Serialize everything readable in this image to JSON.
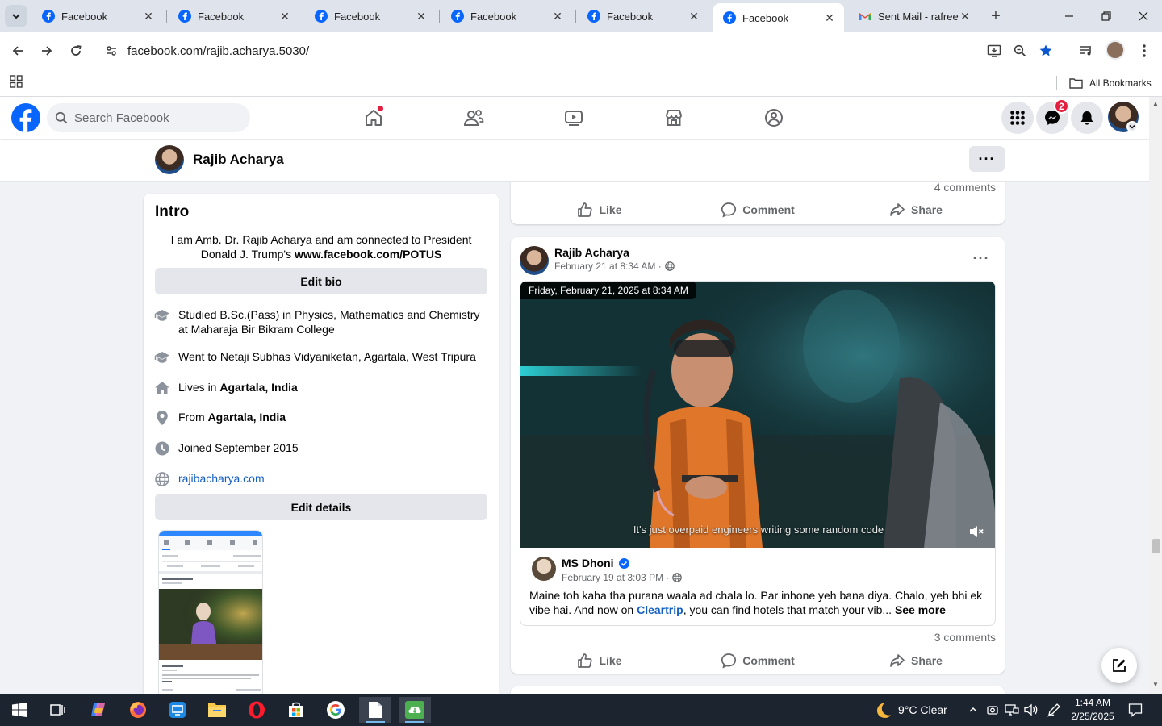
{
  "browser": {
    "tabs": [
      {
        "title": "Facebook",
        "active": false
      },
      {
        "title": "Facebook",
        "active": false
      },
      {
        "title": "Facebook",
        "active": false
      },
      {
        "title": "Facebook",
        "active": false
      },
      {
        "title": "Facebook",
        "active": false
      },
      {
        "title": "Facebook",
        "active": true
      },
      {
        "title": "Sent Mail - rafree",
        "active": false
      }
    ],
    "url": "facebook.com/rajib.acharya.5030/",
    "bookmarks_label": "All Bookmarks"
  },
  "fb": {
    "search_placeholder": "Search Facebook",
    "messenger_badge": "2",
    "profile_name": "Rajib Acharya",
    "more_label": "···"
  },
  "intro": {
    "title": "Intro",
    "bio_text": "I am Amb. Dr. Rajib Acharya and am connected to President Donald J. Trump's ",
    "bio_link": "www.facebook.com/POTUS",
    "edit_bio": "Edit bio",
    "items": [
      {
        "icon": "education-icon",
        "pre": "Studied B.Sc.(Pass) in Physics, Mathematics and Chemistry at Maharaja Bir Bikram College",
        "bold": "",
        "post": ""
      },
      {
        "icon": "education-icon",
        "pre": "Went to Netaji Subhas Vidyaniketan, Agartala, West Tripura",
        "bold": "",
        "post": ""
      },
      {
        "icon": "home-icon",
        "pre": "Lives in ",
        "bold": "Agartala, India",
        "post": ""
      },
      {
        "icon": "location-pin-icon",
        "pre": "From ",
        "bold": "Agartala, India",
        "post": ""
      },
      {
        "icon": "clock-icon",
        "pre": "Joined September 2015",
        "bold": "",
        "post": ""
      }
    ],
    "website": "rajibacharya.com",
    "edit_details": "Edit details"
  },
  "post_top": {
    "comments": "4 comments",
    "like": "Like",
    "comment": "Comment",
    "share": "Share"
  },
  "post": {
    "author": "Rajib Acharya",
    "time": "February 21 at 8:34 AM ·",
    "dots": "···",
    "tooltip": "Friday, February 21, 2025 at 8:34 AM",
    "video_caption": "It's just overpaid engineers writing some random code",
    "shared_author": "MS Dhoni",
    "shared_time": "February 19 at 3:03 PM ·",
    "shared_text_pre": "Maine toh kaha tha purana waala ad chala lo. Par inhone yeh bana diya. Chalo, yeh bhi ek vibe hai. And now on ",
    "shared_link": "Cleartrip",
    "shared_text_post": ", you can find hotels that match your vib... ",
    "see_more": "See more",
    "comments": "3 comments",
    "like": "Like",
    "comment": "Comment",
    "share": "Share"
  },
  "taskbar": {
    "weather": "9°C  Clear",
    "time": "1:44 AM",
    "date": "2/25/2025"
  },
  "colors": {
    "facebook_blue": "#0866ff",
    "link_blue": "#1660c4",
    "badge_red": "#e41e3f"
  }
}
